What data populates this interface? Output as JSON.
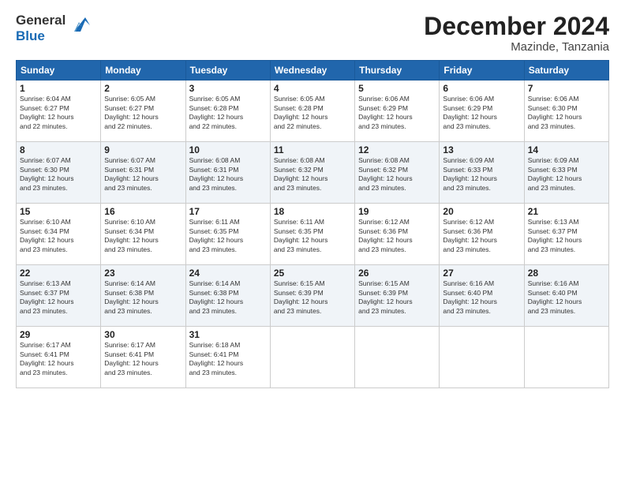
{
  "logo": {
    "text_general": "General",
    "text_blue": "Blue"
  },
  "title": "December 2024",
  "subtitle": "Mazinde, Tanzania",
  "days_header": [
    "Sunday",
    "Monday",
    "Tuesday",
    "Wednesday",
    "Thursday",
    "Friday",
    "Saturday"
  ],
  "weeks": [
    [
      {
        "day": "1",
        "lines": [
          "Sunrise: 6:04 AM",
          "Sunset: 6:27 PM",
          "Daylight: 12 hours",
          "and 22 minutes."
        ]
      },
      {
        "day": "2",
        "lines": [
          "Sunrise: 6:05 AM",
          "Sunset: 6:27 PM",
          "Daylight: 12 hours",
          "and 22 minutes."
        ]
      },
      {
        "day": "3",
        "lines": [
          "Sunrise: 6:05 AM",
          "Sunset: 6:28 PM",
          "Daylight: 12 hours",
          "and 22 minutes."
        ]
      },
      {
        "day": "4",
        "lines": [
          "Sunrise: 6:05 AM",
          "Sunset: 6:28 PM",
          "Daylight: 12 hours",
          "and 22 minutes."
        ]
      },
      {
        "day": "5",
        "lines": [
          "Sunrise: 6:06 AM",
          "Sunset: 6:29 PM",
          "Daylight: 12 hours",
          "and 23 minutes."
        ]
      },
      {
        "day": "6",
        "lines": [
          "Sunrise: 6:06 AM",
          "Sunset: 6:29 PM",
          "Daylight: 12 hours",
          "and 23 minutes."
        ]
      },
      {
        "day": "7",
        "lines": [
          "Sunrise: 6:06 AM",
          "Sunset: 6:30 PM",
          "Daylight: 12 hours",
          "and 23 minutes."
        ]
      }
    ],
    [
      {
        "day": "8",
        "lines": [
          "Sunrise: 6:07 AM",
          "Sunset: 6:30 PM",
          "Daylight: 12 hours",
          "and 23 minutes."
        ]
      },
      {
        "day": "9",
        "lines": [
          "Sunrise: 6:07 AM",
          "Sunset: 6:31 PM",
          "Daylight: 12 hours",
          "and 23 minutes."
        ]
      },
      {
        "day": "10",
        "lines": [
          "Sunrise: 6:08 AM",
          "Sunset: 6:31 PM",
          "Daylight: 12 hours",
          "and 23 minutes."
        ]
      },
      {
        "day": "11",
        "lines": [
          "Sunrise: 6:08 AM",
          "Sunset: 6:32 PM",
          "Daylight: 12 hours",
          "and 23 minutes."
        ]
      },
      {
        "day": "12",
        "lines": [
          "Sunrise: 6:08 AM",
          "Sunset: 6:32 PM",
          "Daylight: 12 hours",
          "and 23 minutes."
        ]
      },
      {
        "day": "13",
        "lines": [
          "Sunrise: 6:09 AM",
          "Sunset: 6:33 PM",
          "Daylight: 12 hours",
          "and 23 minutes."
        ]
      },
      {
        "day": "14",
        "lines": [
          "Sunrise: 6:09 AM",
          "Sunset: 6:33 PM",
          "Daylight: 12 hours",
          "and 23 minutes."
        ]
      }
    ],
    [
      {
        "day": "15",
        "lines": [
          "Sunrise: 6:10 AM",
          "Sunset: 6:34 PM",
          "Daylight: 12 hours",
          "and 23 minutes."
        ]
      },
      {
        "day": "16",
        "lines": [
          "Sunrise: 6:10 AM",
          "Sunset: 6:34 PM",
          "Daylight: 12 hours",
          "and 23 minutes."
        ]
      },
      {
        "day": "17",
        "lines": [
          "Sunrise: 6:11 AM",
          "Sunset: 6:35 PM",
          "Daylight: 12 hours",
          "and 23 minutes."
        ]
      },
      {
        "day": "18",
        "lines": [
          "Sunrise: 6:11 AM",
          "Sunset: 6:35 PM",
          "Daylight: 12 hours",
          "and 23 minutes."
        ]
      },
      {
        "day": "19",
        "lines": [
          "Sunrise: 6:12 AM",
          "Sunset: 6:36 PM",
          "Daylight: 12 hours",
          "and 23 minutes."
        ]
      },
      {
        "day": "20",
        "lines": [
          "Sunrise: 6:12 AM",
          "Sunset: 6:36 PM",
          "Daylight: 12 hours",
          "and 23 minutes."
        ]
      },
      {
        "day": "21",
        "lines": [
          "Sunrise: 6:13 AM",
          "Sunset: 6:37 PM",
          "Daylight: 12 hours",
          "and 23 minutes."
        ]
      }
    ],
    [
      {
        "day": "22",
        "lines": [
          "Sunrise: 6:13 AM",
          "Sunset: 6:37 PM",
          "Daylight: 12 hours",
          "and 23 minutes."
        ]
      },
      {
        "day": "23",
        "lines": [
          "Sunrise: 6:14 AM",
          "Sunset: 6:38 PM",
          "Daylight: 12 hours",
          "and 23 minutes."
        ]
      },
      {
        "day": "24",
        "lines": [
          "Sunrise: 6:14 AM",
          "Sunset: 6:38 PM",
          "Daylight: 12 hours",
          "and 23 minutes."
        ]
      },
      {
        "day": "25",
        "lines": [
          "Sunrise: 6:15 AM",
          "Sunset: 6:39 PM",
          "Daylight: 12 hours",
          "and 23 minutes."
        ]
      },
      {
        "day": "26",
        "lines": [
          "Sunrise: 6:15 AM",
          "Sunset: 6:39 PM",
          "Daylight: 12 hours",
          "and 23 minutes."
        ]
      },
      {
        "day": "27",
        "lines": [
          "Sunrise: 6:16 AM",
          "Sunset: 6:40 PM",
          "Daylight: 12 hours",
          "and 23 minutes."
        ]
      },
      {
        "day": "28",
        "lines": [
          "Sunrise: 6:16 AM",
          "Sunset: 6:40 PM",
          "Daylight: 12 hours",
          "and 23 minutes."
        ]
      }
    ],
    [
      {
        "day": "29",
        "lines": [
          "Sunrise: 6:17 AM",
          "Sunset: 6:41 PM",
          "Daylight: 12 hours",
          "and 23 minutes."
        ]
      },
      {
        "day": "30",
        "lines": [
          "Sunrise: 6:17 AM",
          "Sunset: 6:41 PM",
          "Daylight: 12 hours",
          "and 23 minutes."
        ]
      },
      {
        "day": "31",
        "lines": [
          "Sunrise: 6:18 AM",
          "Sunset: 6:41 PM",
          "Daylight: 12 hours",
          "and 23 minutes."
        ]
      },
      null,
      null,
      null,
      null
    ]
  ]
}
